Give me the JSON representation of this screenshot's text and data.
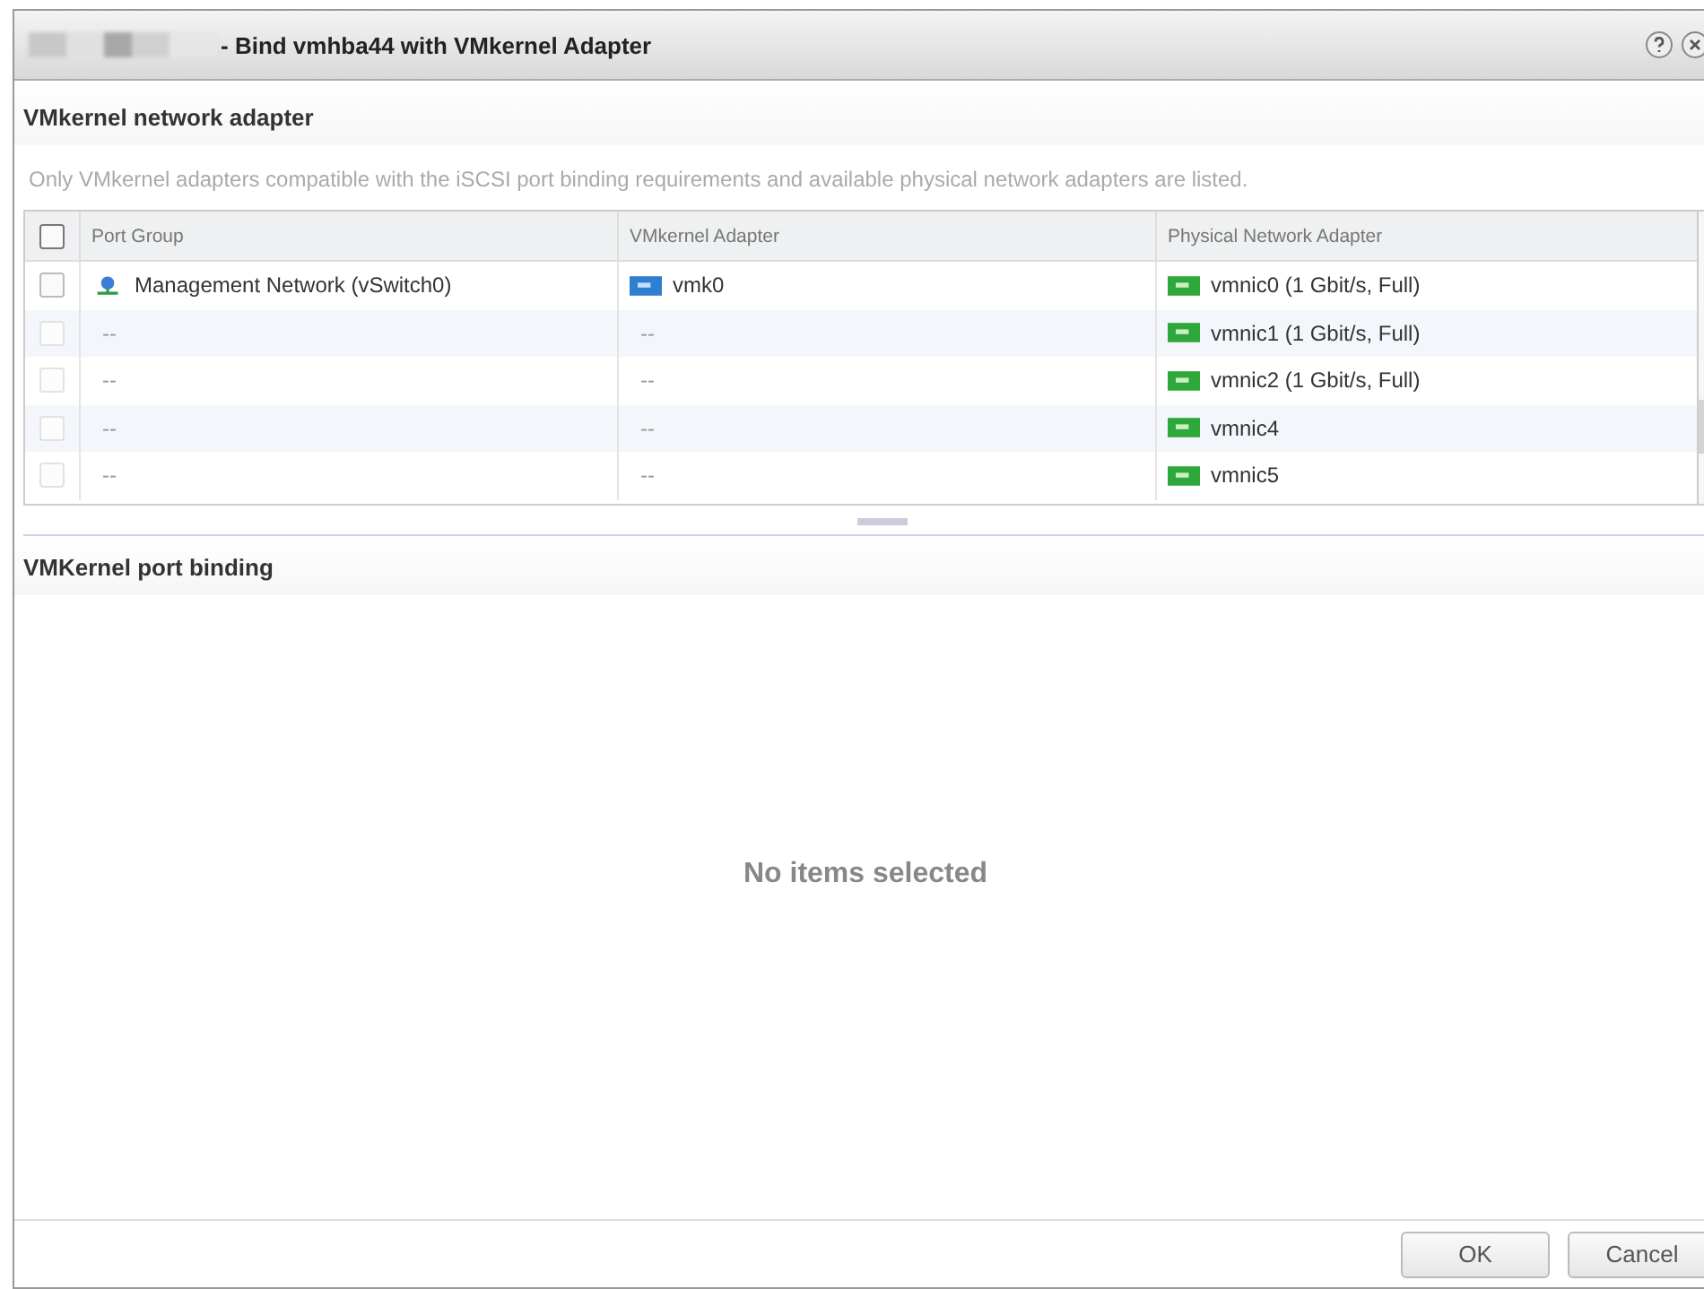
{
  "window": {
    "title": "- Bind vmhba44 with VMkernel Adapter"
  },
  "adapter_section": {
    "title": "VMkernel network adapter",
    "description": "Only VMkernel adapters compatible with the iSCSI port binding requirements and available physical network adapters are listed."
  },
  "table": {
    "select_all": {
      "checked": false
    },
    "columns": [
      "Port Group",
      "VMkernel Adapter",
      "Physical Network Adapter"
    ],
    "rows": [
      {
        "kind": "adapter",
        "checked": false,
        "disabled": false,
        "port_group": "Management Network (vSwitch0)",
        "vmkernel_adapter": "vmk0",
        "physical_adapter": "vmnic0 (1 Gbit/s, Full)"
      },
      {
        "kind": "placeholder",
        "checked": false,
        "disabled": true,
        "port_group": "--",
        "vmkernel_adapter": "--",
        "physical_adapter": "vmnic1 (1 Gbit/s, Full)"
      },
      {
        "kind": "placeholder",
        "checked": false,
        "disabled": true,
        "port_group": "--",
        "vmkernel_adapter": "--",
        "physical_adapter": "vmnic2 (1 Gbit/s, Full)"
      },
      {
        "kind": "placeholder",
        "checked": false,
        "disabled": true,
        "port_group": "--",
        "vmkernel_adapter": "--",
        "physical_adapter": "vmnic4"
      },
      {
        "kind": "placeholder",
        "checked": false,
        "disabled": true,
        "port_group": "--",
        "vmkernel_adapter": "--",
        "physical_adapter": "vmnic5"
      }
    ]
  },
  "binding_section": {
    "title": "VMKernel port binding",
    "empty_message": "No items selected"
  },
  "buttons": [
    "OK",
    "Cancel"
  ]
}
